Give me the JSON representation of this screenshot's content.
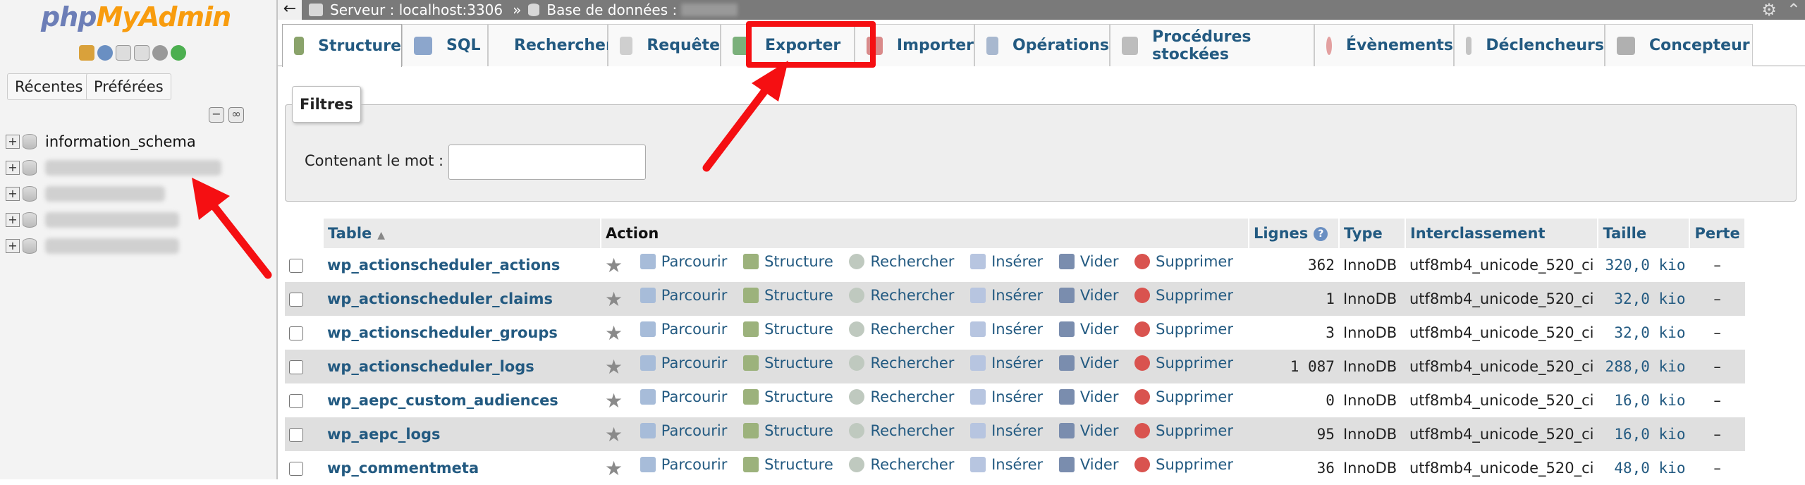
{
  "logo": {
    "php": "php",
    "myadmin": "MyAdmin"
  },
  "nav": {
    "recent_label": "Récentes",
    "favorites_label": "Préférées",
    "tree": [
      {
        "label": "information_schema",
        "blurred": false
      },
      {
        "label": "",
        "blurred": true
      },
      {
        "label": "",
        "blurred": true
      },
      {
        "label": "",
        "blurred": true
      },
      {
        "label": "",
        "blurred": true
      }
    ]
  },
  "breadcrumb": {
    "server": "Serveur : localhost:3306",
    "separator": "»",
    "database": "Base de données :"
  },
  "tabs": [
    {
      "label": "Structure",
      "active": true
    },
    {
      "label": "SQL"
    },
    {
      "label": "Rechercher"
    },
    {
      "label": "Requête"
    },
    {
      "label": "Exporter",
      "highlighted": true
    },
    {
      "label": "Importer"
    },
    {
      "label": "Opérations"
    },
    {
      "label": "Procédures stockées"
    },
    {
      "label": "Évènements"
    },
    {
      "label": "Déclencheurs"
    },
    {
      "label": "Concepteur"
    }
  ],
  "filters": {
    "legend": "Filtres",
    "label": "Contenant le mot :",
    "value": ""
  },
  "table": {
    "headers": {
      "table": "Table",
      "action": "Action",
      "rows": "Lignes",
      "type": "Type",
      "collation": "Interclassement",
      "size": "Taille",
      "overhead": "Perte"
    },
    "actions": [
      "Parcourir",
      "Structure",
      "Rechercher",
      "Insérer",
      "Vider",
      "Supprimer"
    ],
    "rows": [
      {
        "name": "wp_actionscheduler_actions",
        "rows": "362",
        "type": "InnoDB",
        "collation": "utf8mb4_unicode_520_ci",
        "size": "320,0 kio",
        "overhead": "–"
      },
      {
        "name": "wp_actionscheduler_claims",
        "rows": "1",
        "type": "InnoDB",
        "collation": "utf8mb4_unicode_520_ci",
        "size": "32,0 kio",
        "overhead": "–"
      },
      {
        "name": "wp_actionscheduler_groups",
        "rows": "3",
        "type": "InnoDB",
        "collation": "utf8mb4_unicode_520_ci",
        "size": "32,0 kio",
        "overhead": "–"
      },
      {
        "name": "wp_actionscheduler_logs",
        "rows": "1 087",
        "type": "InnoDB",
        "collation": "utf8mb4_unicode_520_ci",
        "size": "288,0 kio",
        "overhead": "–"
      },
      {
        "name": "wp_aepc_custom_audiences",
        "rows": "0",
        "type": "InnoDB",
        "collation": "utf8mb4_unicode_520_ci",
        "size": "16,0 kio",
        "overhead": "–"
      },
      {
        "name": "wp_aepc_logs",
        "rows": "95",
        "type": "InnoDB",
        "collation": "utf8mb4_unicode_520_ci",
        "size": "16,0 kio",
        "overhead": "–"
      },
      {
        "name": "wp_commentmeta",
        "rows": "36",
        "type": "InnoDB",
        "collation": "utf8mb4_unicode_520_ci",
        "size": "48,0 kio",
        "overhead": "–"
      }
    ]
  },
  "colors": {
    "link": "#235a81",
    "highlight": "#f50f12",
    "logo_php": "#6c7eb7",
    "logo_admin": "#f89c0e"
  }
}
